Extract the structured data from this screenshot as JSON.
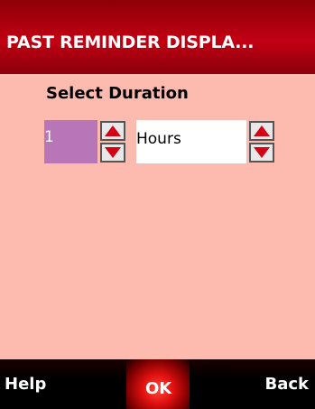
{
  "header": {
    "title": "PAST REMINDER DISPLA..."
  },
  "form": {
    "label": "Select Duration",
    "number_value": "1",
    "unit_value": "Hours"
  },
  "softkeys": {
    "left": "Help",
    "center": "OK",
    "right": "Back"
  },
  "icons": {
    "stepper_up": "arrow-up-icon",
    "stepper_down": "arrow-down-icon"
  },
  "colors": {
    "titlebar": "#c10013",
    "background": "#fdbaaf",
    "number_field": "#b876b8",
    "softkey_bar": "#000000",
    "ok_highlight": "#e01010",
    "arrow": "#d40016"
  }
}
